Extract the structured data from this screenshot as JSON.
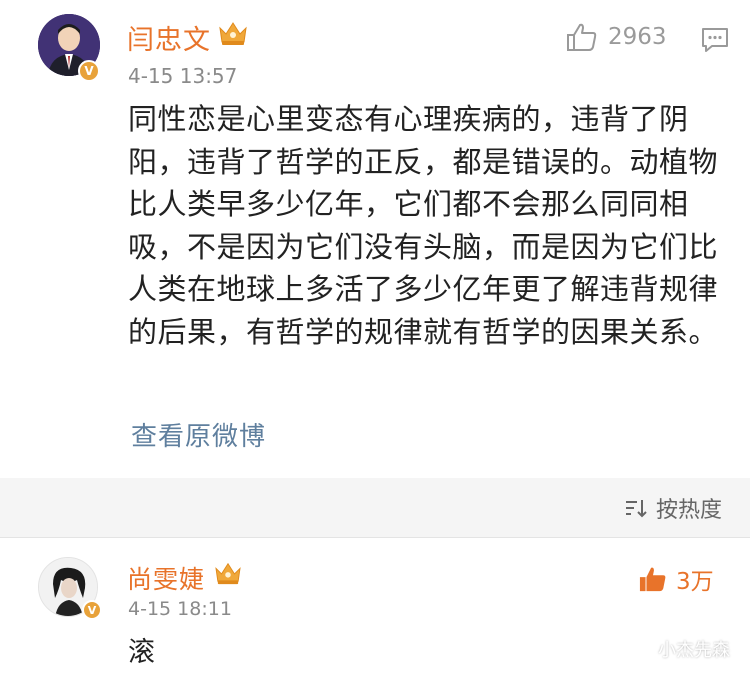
{
  "post": {
    "author": "闫忠文",
    "timestamp": "4-15 13:57",
    "likes": "2963",
    "text": "同性恋是心里变态有心理疾病的，违背了阴阳，违背了哲学的正反，都是错误的。动植物比人类早多少亿年，它们都不会那么同同相吸，不是因为它们没有头脑，而是因为它们比人类在地球上多活了多少亿年更了解违背规律的后果，有哲学的规律就有哲学的因果关系。",
    "view_original": "查看原微博",
    "verified_mark": "V"
  },
  "sort": {
    "label": "按热度"
  },
  "reply": {
    "author": "尚雯婕",
    "timestamp": "4-15 18:11",
    "likes": "3万",
    "text": "滚",
    "verified_mark": "V"
  },
  "watermark": {
    "text": "小杰先森"
  },
  "colors": {
    "username": "#e8732a",
    "link": "#5f7f9e",
    "crown": "#f0a83a",
    "verified_badge": "#e8a23a",
    "band": "#f5f5f5"
  },
  "icons": {
    "post_like": "thumbs-up-outline-icon",
    "comment": "comment-icon",
    "crown": "crown-icon",
    "sort": "sort-icon",
    "reply_like": "thumbs-up-filled-icon",
    "watermark": "wechat-icon"
  }
}
